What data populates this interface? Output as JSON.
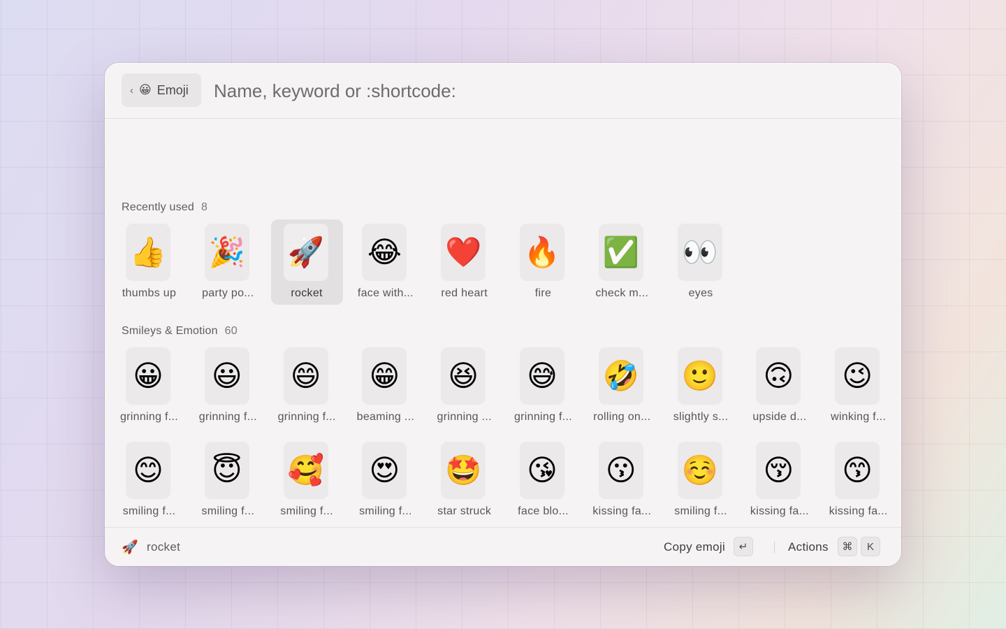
{
  "search": {
    "back_chip": {
      "chevron": "‹",
      "emoji": "😀",
      "label": "Emoji"
    },
    "placeholder": "Name, keyword or :shortcode:"
  },
  "sections": {
    "recent": {
      "title": "Recently used",
      "count": "8"
    },
    "smileys": {
      "title": "Smileys & Emotion",
      "count": "60"
    }
  },
  "recent_items": [
    {
      "emoji": "👍",
      "label": "thumbs up"
    },
    {
      "emoji": "🎉",
      "label": "party po..."
    },
    {
      "emoji": "🚀",
      "label": "rocket",
      "selected": true
    },
    {
      "emoji": "😂",
      "label": "face with..."
    },
    {
      "emoji": "❤️",
      "label": "red heart"
    },
    {
      "emoji": "🔥",
      "label": "fire"
    },
    {
      "emoji": "✅",
      "label": "check m..."
    },
    {
      "emoji": "👀",
      "label": "eyes"
    }
  ],
  "smiley_rows": [
    [
      {
        "emoji": "😀",
        "label": "grinning f..."
      },
      {
        "emoji": "😃",
        "label": "grinning f..."
      },
      {
        "emoji": "😄",
        "label": "grinning f..."
      },
      {
        "emoji": "😁",
        "label": "beaming ..."
      },
      {
        "emoji": "😆",
        "label": "grinning ..."
      },
      {
        "emoji": "😅",
        "label": "grinning f..."
      },
      {
        "emoji": "🤣",
        "label": "rolling on..."
      },
      {
        "emoji": "🙂",
        "label": "slightly s..."
      },
      {
        "emoji": "🙃",
        "label": "upside d..."
      },
      {
        "emoji": "😉",
        "label": "winking f..."
      }
    ],
    [
      {
        "emoji": "😊",
        "label": "smiling f..."
      },
      {
        "emoji": "😇",
        "label": "smiling f..."
      },
      {
        "emoji": "🥰",
        "label": "smiling f..."
      },
      {
        "emoji": "😍",
        "label": "smiling f..."
      },
      {
        "emoji": "🤩",
        "label": "star struck"
      },
      {
        "emoji": "😘",
        "label": "face blo..."
      },
      {
        "emoji": "😗",
        "label": "kissing fa..."
      },
      {
        "emoji": "☺️",
        "label": "smiling f..."
      },
      {
        "emoji": "😚",
        "label": "kissing fa..."
      },
      {
        "emoji": "😙",
        "label": "kissing fa..."
      }
    ],
    [
      {
        "emoji": "😋",
        "label": ""
      },
      {
        "emoji": "😛",
        "label": ""
      },
      {
        "emoji": "😜",
        "label": ""
      },
      {
        "emoji": "🤪",
        "label": ""
      },
      {
        "emoji": "😝",
        "label": ""
      },
      {
        "emoji": "🤑",
        "label": ""
      },
      {
        "emoji": "🤗",
        "label": ""
      },
      {
        "emoji": "🤭",
        "label": ""
      },
      {
        "emoji": "🤫",
        "label": ""
      },
      {
        "emoji": "🤔",
        "label": ""
      }
    ]
  ],
  "footer": {
    "selected_emoji": "🚀",
    "selected_name": "rocket",
    "primary_action": "Copy emoji",
    "primary_key": "↵",
    "secondary_action": "Actions",
    "secondary_keys": [
      "⌘",
      "K"
    ]
  }
}
